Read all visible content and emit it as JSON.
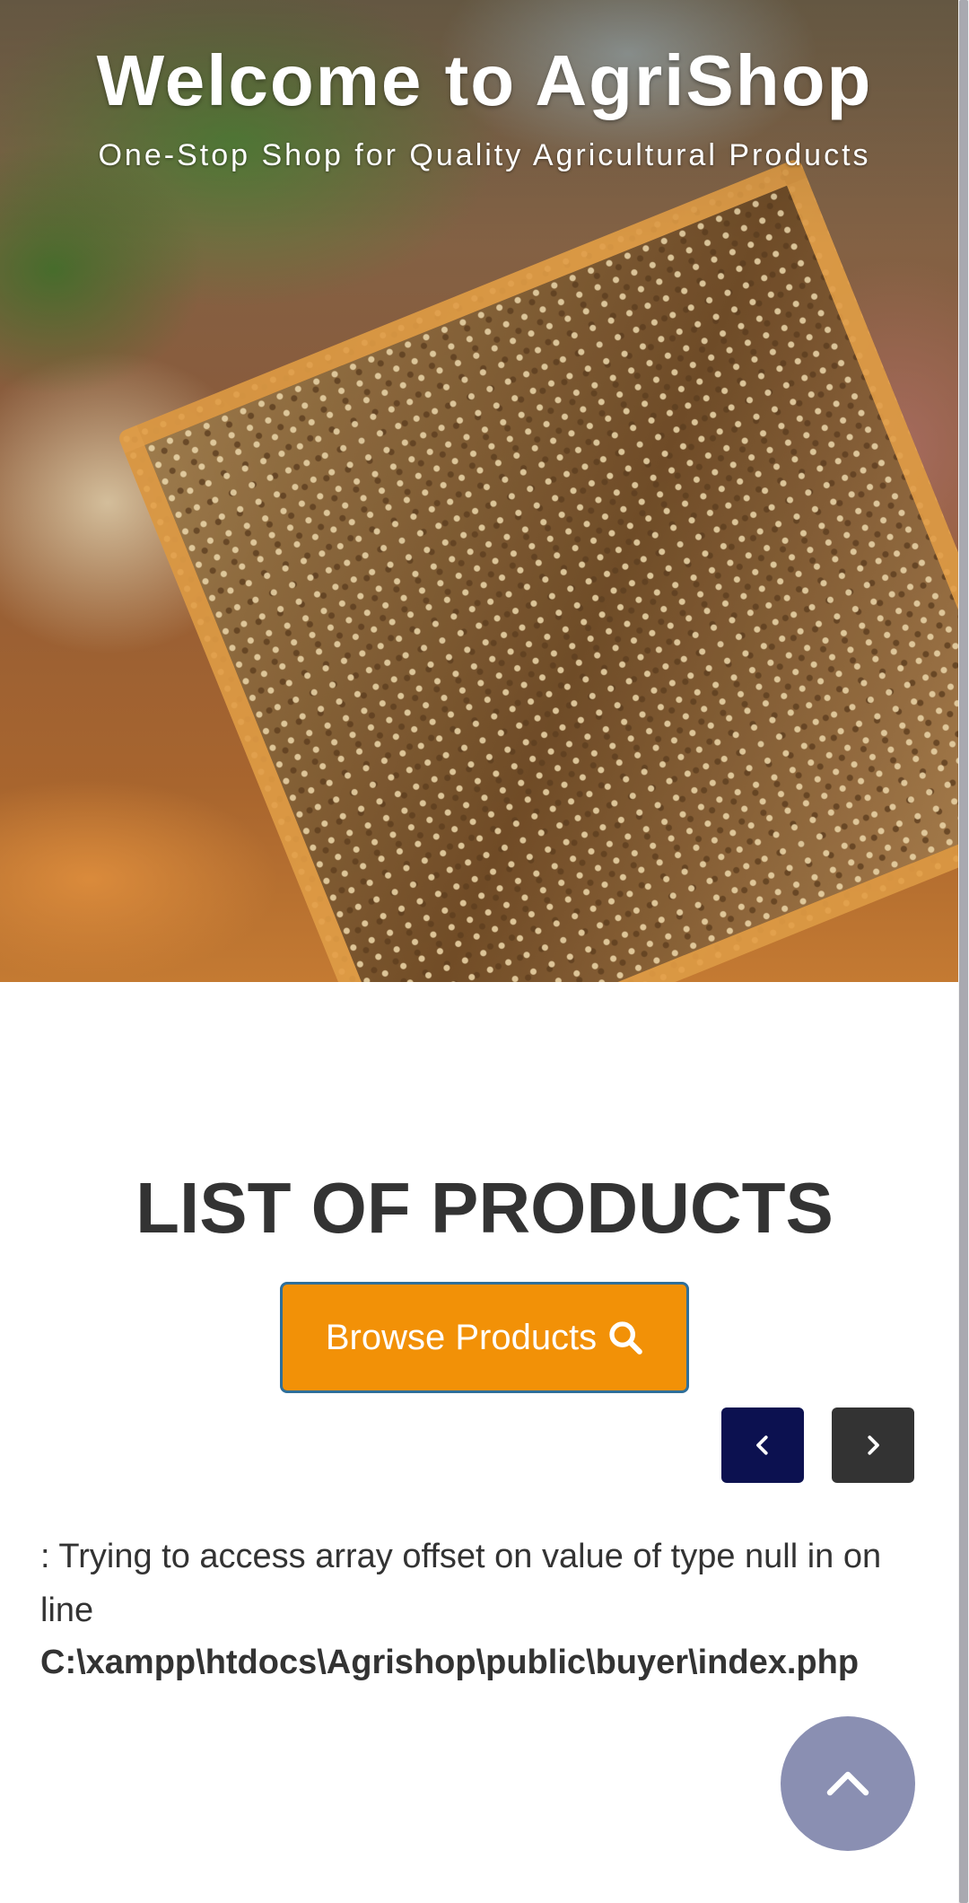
{
  "hero": {
    "title": "Welcome to AgriShop",
    "subtitle": "One-Stop Shop for Quality Agricultural Products"
  },
  "products": {
    "heading": "LIST OF PRODUCTS",
    "browse_label": "Browse Products",
    "browse_icon": "search-icon",
    "prev_icon": "chevron-left-icon",
    "next_icon": "chevron-right-icon"
  },
  "error": {
    "message": ": Trying to access array offset on value of type null in on line",
    "path": "C:\\xampp\\htdocs\\Agrishop\\public\\buyer\\index.php"
  },
  "scroll_top": {
    "icon": "chevron-up-icon"
  },
  "colors": {
    "browse_button": "#f29107",
    "prev_button": "#0c1150",
    "next_button": "#333333",
    "scroll_top": "#8a8fb2",
    "heading_text": "#333333"
  }
}
